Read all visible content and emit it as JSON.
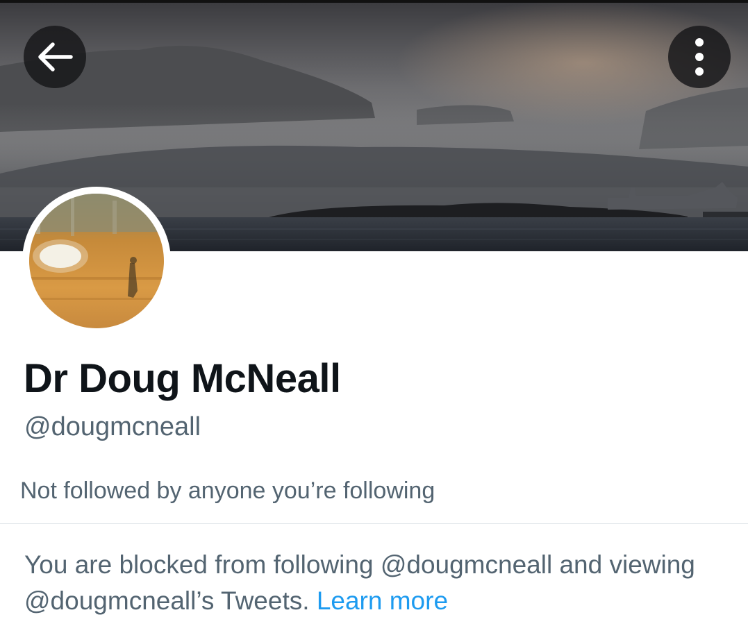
{
  "header": {
    "back_icon": "arrow-left-icon",
    "more_icon": "vertical-ellipsis-icon",
    "banner_description_colors": {
      "sky": "#8a8b8e",
      "water": "#2b2f36"
    }
  },
  "profile": {
    "display_name": "Dr Doug McNeall",
    "handle": "@dougmcneall",
    "followers_note": "Not followed by anyone you’re following"
  },
  "blocked": {
    "message": "You are blocked from following @dougmcneall and viewing @dougmcneall’s Tweets.",
    "link_label": "Learn more"
  },
  "colors": {
    "primary_text": "#0f1419",
    "secondary_text": "#536471",
    "link": "#1d9bf0"
  }
}
